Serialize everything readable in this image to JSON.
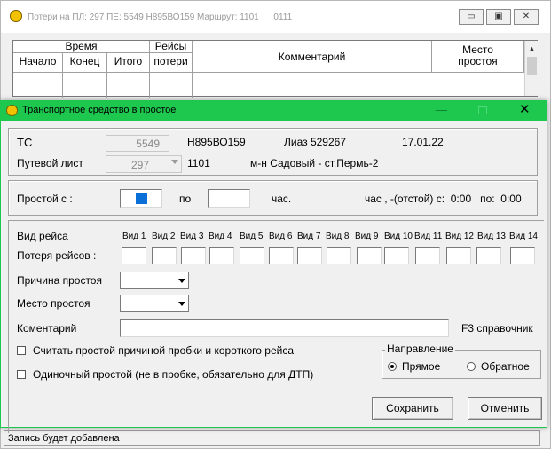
{
  "background": {
    "title": "Потери на ПЛ: 297 ПЕ: 5549 Н895ВО159 Маршрут: 1101      0111",
    "grid": {
      "group_time": "Время",
      "group_trips": "Рейсы",
      "col_start": "Начало",
      "col_end": "Конец",
      "col_total": "Итого",
      "col_losses": "потери",
      "col_comment": "Комментарий",
      "col_place_1": "Место",
      "col_place_2": "простоя"
    },
    "status": "Запись будет добавлена"
  },
  "dialog": {
    "title": "Транспортное средство в простое",
    "vehicle": {
      "ts_label": "ТС",
      "ts_value": "5549",
      "plate": "Н895ВО159",
      "model": "Лиаз 529267",
      "date": "17.01.22",
      "waybill_label": "Путевой лист",
      "waybill_value": "297",
      "route": "1101",
      "route_name": "м-н Садовый - ст.Пермь-2"
    },
    "downtime": {
      "from_label": "Простой  с :",
      "to_label": "по",
      "hours_label": "час.",
      "summary": "час , -(отстой) с:  0:00   по:  0:00"
    },
    "trips": {
      "type_label": "Вид рейса",
      "loss_label": "Потеря рейсов :",
      "types": [
        "Вид 1",
        "Вид 2",
        "Вид 3",
        "Вид 4",
        "Вид 5",
        "Вид 6",
        "Вид 7",
        "Вид 8",
        "Вид 9",
        "Вид 10",
        "Вид 11",
        "Вид 12",
        "Вид 13",
        "Вид 14"
      ]
    },
    "reason_label": "Причина простоя",
    "place_label": "Место простоя",
    "comment_label": "Коментарий",
    "comment_hint": "F3 справочник",
    "options": {
      "traffic_jam": "Считать простой причиной пробки и короткого рейса",
      "single": "Одиночный простой  (не в пробке,  обязательно для ДТП)"
    },
    "direction": {
      "legend": "Направление",
      "forward": "Прямое",
      "backward": "Обратное"
    },
    "save_button": "Сохранить",
    "cancel_button": "Отменить"
  }
}
